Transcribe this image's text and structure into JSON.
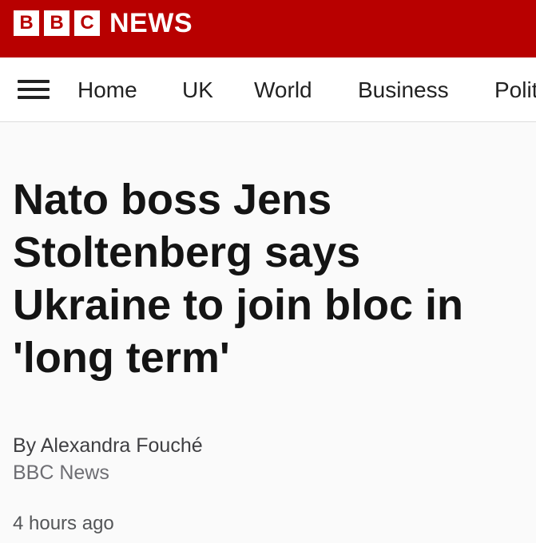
{
  "header": {
    "logo_letters": [
      "B",
      "B",
      "C"
    ],
    "logo_news": "NEWS",
    "brand_color": "#b80000"
  },
  "nav": {
    "menu_icon": "hamburger-menu-icon",
    "items": [
      {
        "label": "Home"
      },
      {
        "label": "UK"
      },
      {
        "label": "World"
      },
      {
        "label": "Business"
      },
      {
        "label": "Politics"
      }
    ]
  },
  "article": {
    "headline": "Nato boss Jens Stoltenberg says Ukraine to join bloc in 'long term'",
    "author": "By Alexandra Fouché",
    "source": "BBC News",
    "timestamp": "4 hours ago"
  }
}
